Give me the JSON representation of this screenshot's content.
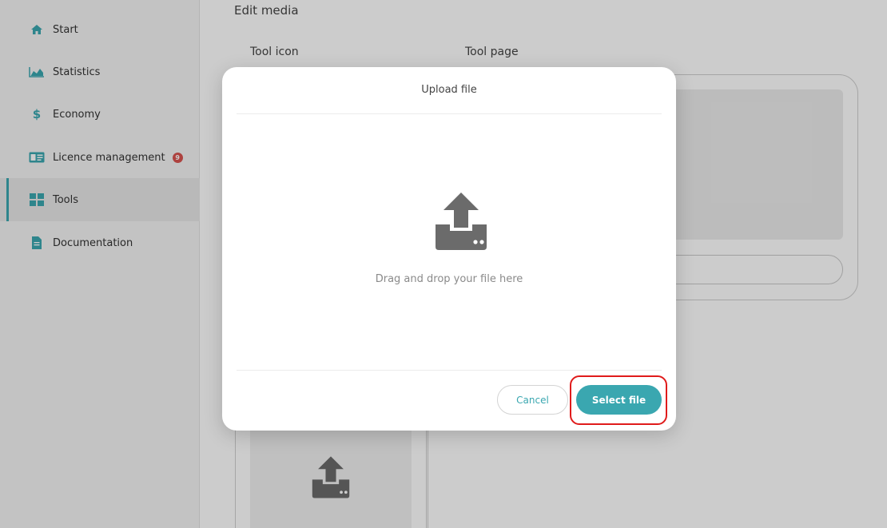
{
  "sidebar": {
    "items": [
      {
        "label": "Start",
        "icon": "home-icon"
      },
      {
        "label": "Statistics",
        "icon": "area-chart-icon"
      },
      {
        "label": "Economy",
        "icon": "dollar-icon"
      },
      {
        "label": "Licence management",
        "icon": "id-card-icon",
        "badge": "9"
      },
      {
        "label": "Tools",
        "icon": "grid-icon",
        "active": true
      },
      {
        "label": "Documentation",
        "icon": "document-icon"
      }
    ]
  },
  "main": {
    "heading": "Edit media",
    "tool_icon_label": "Tool icon",
    "tool_page_label": "Tool page"
  },
  "modal": {
    "title": "Upload file",
    "drop_text": "Drag and drop your file here",
    "cancel_label": "Cancel",
    "select_label": "Select file"
  },
  "colors": {
    "accent": "#3aa7b0",
    "badge": "#d9534f",
    "highlight": "#e01b1b"
  }
}
